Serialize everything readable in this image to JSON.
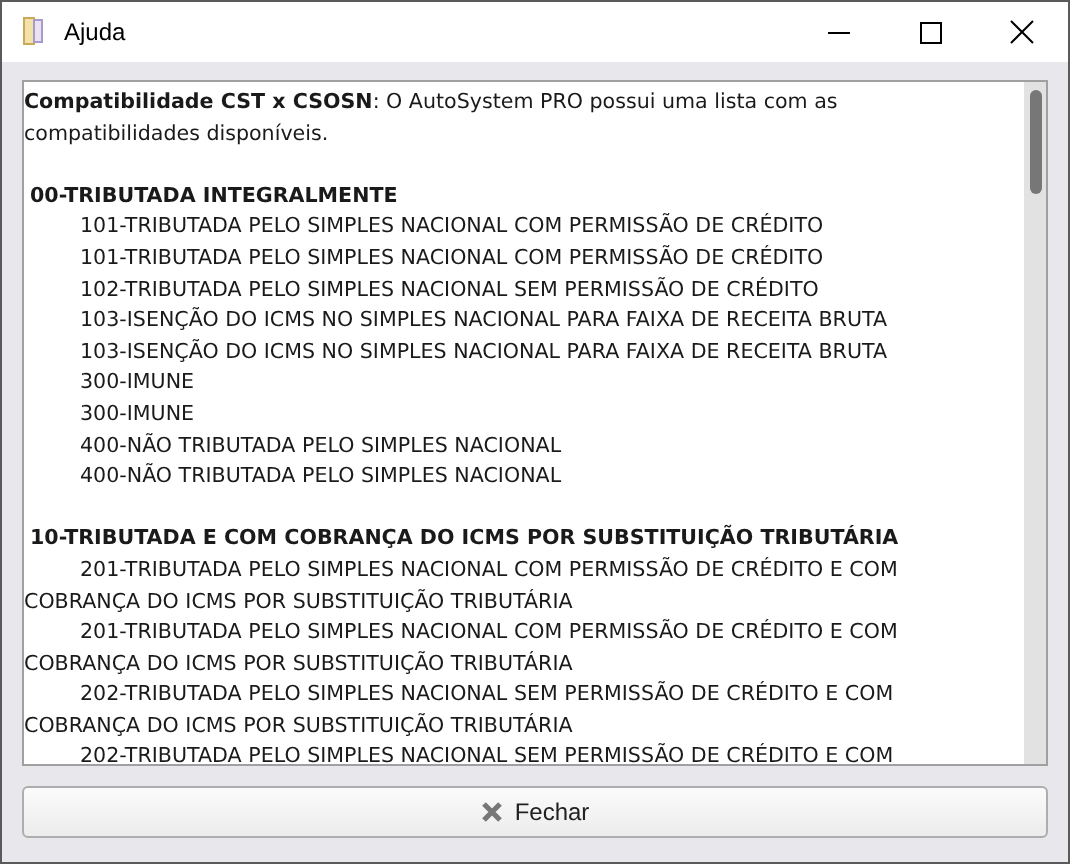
{
  "window": {
    "title": "Ajuda"
  },
  "intro": "**Compatibilidade CST x CSOSN**: O AutoSystem PRO possui uma lista com as compatibilidades disponíveis.",
  "sections": [
    {
      "heading": "00-TRIBUTADA INTEGRALMENTE",
      "items": [
        "101-TRIBUTADA PELO SIMPLES NACIONAL COM PERMISSÃO DE CRÉDITO",
        "101-TRIBUTADA PELO SIMPLES NACIONAL COM PERMISSÃO DE CRÉDITO",
        "102-TRIBUTADA PELO SIMPLES NACIONAL SEM PERMISSÃO DE CRÉDITO",
        "103-ISENÇÃO DO ICMS NO SIMPLES NACIONAL PARA FAIXA DE RECEITA BRUTA",
        "103-ISENÇÃO DO ICMS NO SIMPLES NACIONAL PARA FAIXA DE RECEITA BRUTA",
        "300-IMUNE",
        "300-IMUNE",
        "400-NÃO TRIBUTADA PELO SIMPLES NACIONAL",
        "400-NÃO TRIBUTADA PELO SIMPLES NACIONAL"
      ]
    },
    {
      "heading": "10-TRIBUTADA E COM COBRANÇA DO ICMS POR SUBSTITUIÇÃO TRIBUTÁRIA",
      "items": [
        "201-TRIBUTADA PELO SIMPLES NACIONAL COM PERMISSÃO DE CRÉDITO E COM COBRANÇA DO ICMS POR SUBSTITUIÇÃO TRIBUTÁRIA",
        "201-TRIBUTADA PELO SIMPLES NACIONAL COM PERMISSÃO DE CRÉDITO E COM COBRANÇA DO ICMS POR SUBSTITUIÇÃO TRIBUTÁRIA",
        "202-TRIBUTADA PELO SIMPLES NACIONAL SEM PERMISSÃO DE CRÉDITO E COM COBRANÇA DO ICMS POR SUBSTITUIÇÃO TRIBUTÁRIA",
        "202-TRIBUTADA PELO SIMPLES NACIONAL SEM PERMISSÃO DE CRÉDITO E COM"
      ]
    }
  ],
  "close_button": {
    "label": "Fechar"
  }
}
